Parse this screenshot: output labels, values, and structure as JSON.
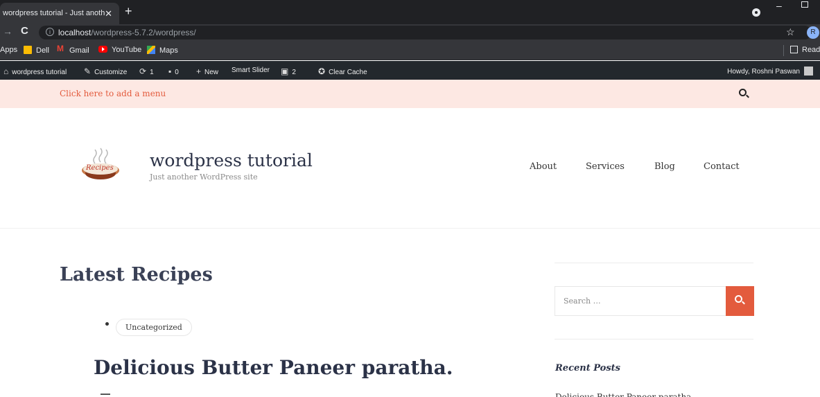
{
  "browser": {
    "tab_title": "wordpress tutorial - Just another",
    "tab_close": "✕",
    "new_tab": "+",
    "url_host": "localhost",
    "url_path": "/wordpress-5.7.2/wordpress/",
    "avatar_letter": "R"
  },
  "bookmarks": {
    "apps": "Apps",
    "items": [
      "Dell",
      "Gmail",
      "YouTube",
      "Maps"
    ],
    "reading_list": "Readi"
  },
  "adminbar": {
    "site": "wordpress tutorial",
    "customize": "Customize",
    "updates": "1",
    "comments": "0",
    "new": "New",
    "smart_slider": "Smart Slider",
    "yoast_count": "2",
    "clear_cache": "Clear Cache",
    "howdy": "Howdy, Roshni Paswan"
  },
  "topstrip": {
    "add_menu": "Click here to add a menu"
  },
  "header": {
    "logo_text": "Recipes",
    "site_title": "wordpress tutorial",
    "site_description": "Just another WordPress site",
    "nav": [
      "About",
      "Services",
      "Blog",
      "Contact"
    ]
  },
  "main": {
    "title": "Latest Recipes",
    "category": "Uncategorized",
    "post_title": "Delicious Butter Paneer paratha."
  },
  "sidebar": {
    "search_placeholder": "Search …",
    "recent_posts_title": "Recent Posts",
    "recent_first": "Delicious Butter Paneer paratha."
  },
  "colors": {
    "accent": "#e35b3d",
    "strip_bg": "#fde8e3",
    "adminbar_bg": "#23282d",
    "chrome_bg": "#35363a"
  }
}
